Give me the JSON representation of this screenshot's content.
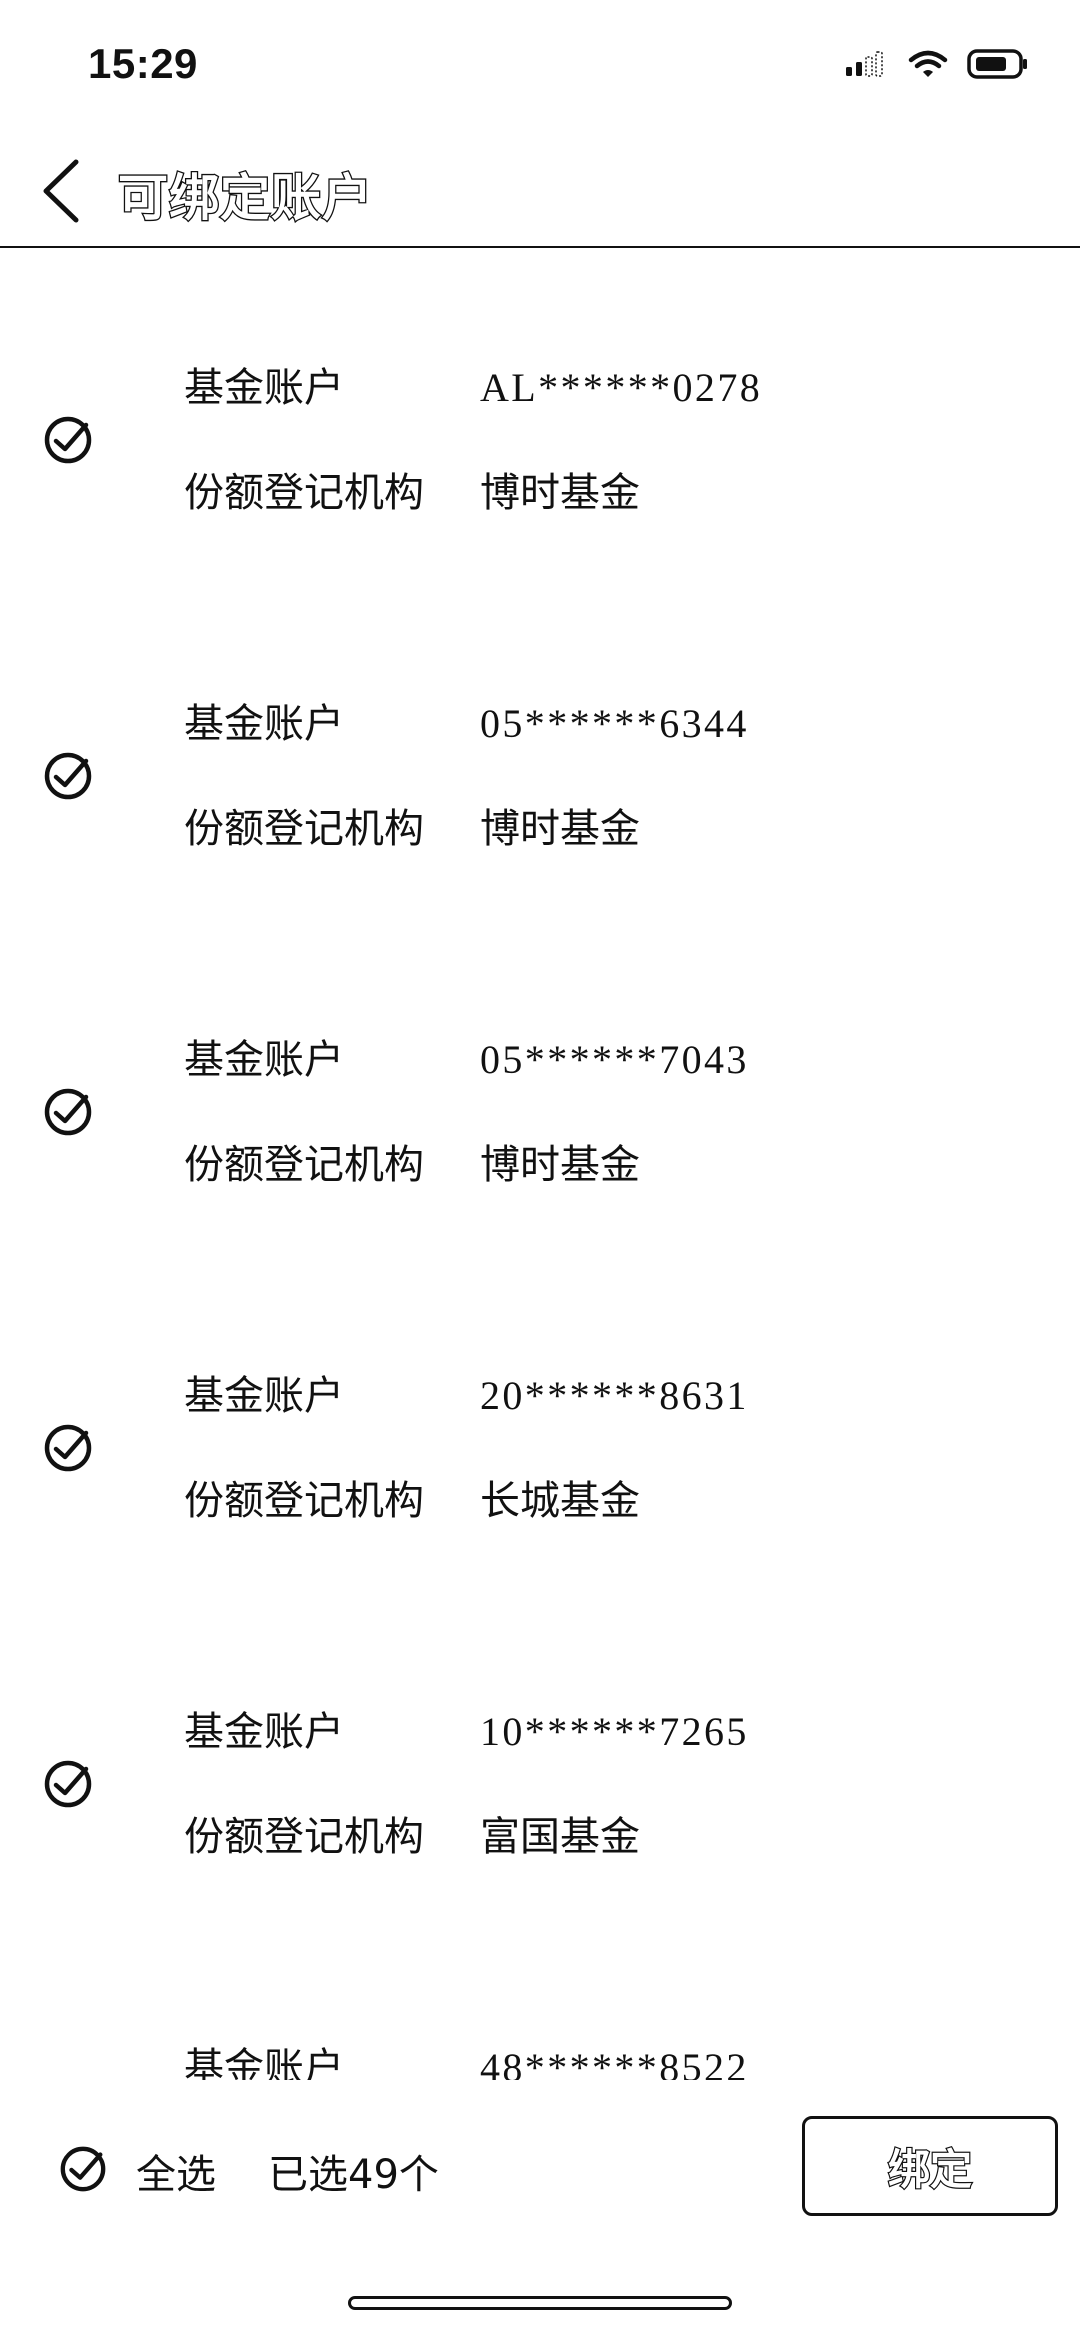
{
  "status_bar": {
    "time": "15:29",
    "icons": [
      "cellular-signal-icon",
      "wifi-icon",
      "battery-icon"
    ]
  },
  "nav": {
    "back_icon": "chevron-left-icon",
    "title": "可绑定账户"
  },
  "accounts": [
    {
      "account_label": "基金账户",
      "account_number": "AL******0278",
      "registrar_label": "份额登记机构",
      "registrar": "博时基金",
      "selected": true
    },
    {
      "account_label": "基金账户",
      "account_number": "05******6344",
      "registrar_label": "份额登记机构",
      "registrar": "博时基金",
      "selected": true
    },
    {
      "account_label": "基金账户",
      "account_number": "05******7043",
      "registrar_label": "份额登记机构",
      "registrar": "博时基金",
      "selected": true
    },
    {
      "account_label": "基金账户",
      "account_number": "20******8631",
      "registrar_label": "份额登记机构",
      "registrar": "长城基金",
      "selected": true
    },
    {
      "account_label": "基金账户",
      "account_number": "10******7265",
      "registrar_label": "份额登记机构",
      "registrar": "富国基金",
      "selected": true
    },
    {
      "account_label": "基金账户",
      "account_number": "48******8522",
      "registrar_label": "",
      "registrar": "",
      "selected": true
    }
  ],
  "bottom_bar": {
    "select_all_label": "全选",
    "selected_count_text": "已选49个",
    "bind_button_label": "绑定",
    "check_icon": "check-circle-icon"
  }
}
